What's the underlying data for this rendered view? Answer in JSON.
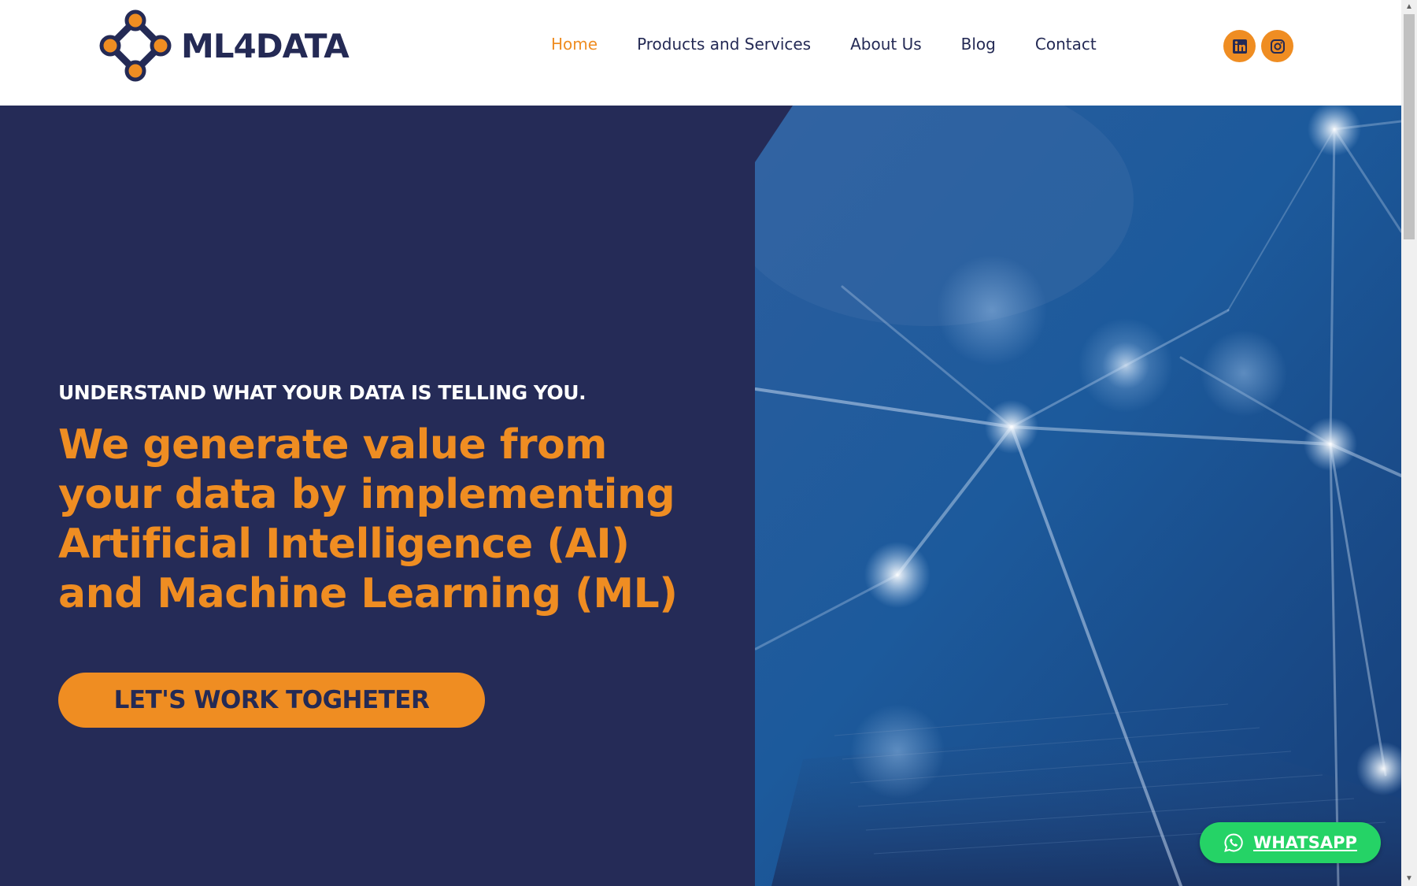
{
  "brand": {
    "name": "ML4DATA",
    "colors": {
      "navy": "#252b57",
      "orange": "#ef8d22",
      "green": "#25d366"
    }
  },
  "nav": {
    "items": [
      {
        "label": "Home",
        "active": true
      },
      {
        "label": "Products and Services",
        "active": false
      },
      {
        "label": "About Us",
        "active": false
      },
      {
        "label": "Blog",
        "active": false
      },
      {
        "label": "Contact",
        "active": false
      }
    ]
  },
  "social": {
    "icons": [
      "linkedin-icon",
      "instagram-icon"
    ]
  },
  "hero": {
    "eyebrow": "UNDERSTAND WHAT YOUR DATA IS TELLING YOU.",
    "headline": "We generate value from your data by implementing Artificial Intelligence (AI) and Machine Learning (ML)",
    "cta": "LET'S WORK TOGHETER"
  },
  "whatsapp": {
    "label": "WHATSAPP",
    "icon": "whatsapp-icon"
  }
}
